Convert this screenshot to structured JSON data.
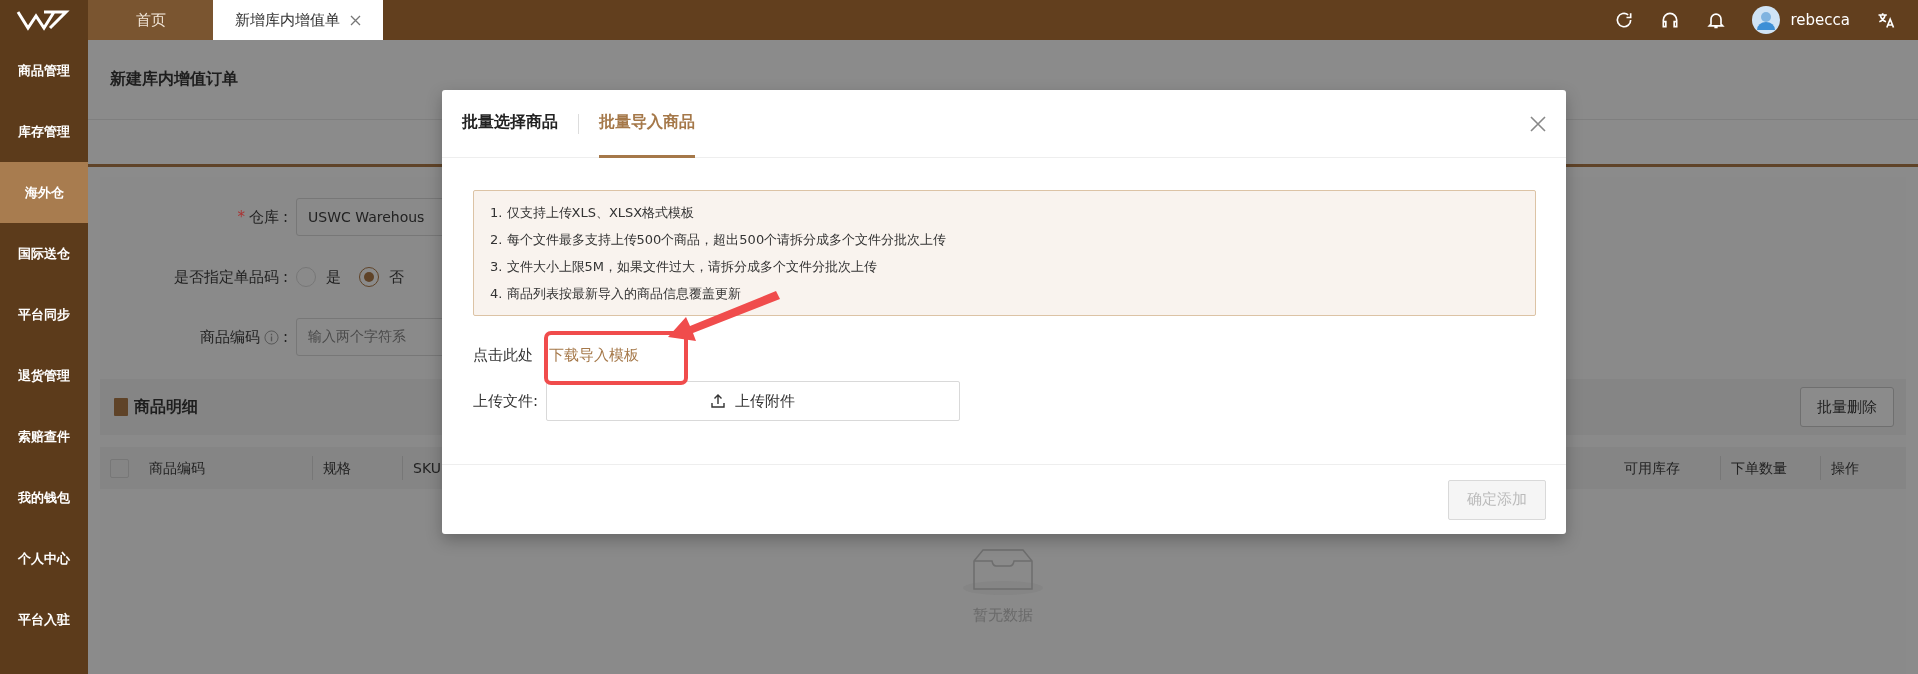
{
  "top_bar": {
    "tabs": [
      {
        "label": "首页",
        "selected": false,
        "closable": false
      },
      {
        "label": "新增库内增值单",
        "selected": true,
        "closable": true
      }
    ],
    "user": "rebecca"
  },
  "sidebar": {
    "items": [
      {
        "label": "商品管理",
        "selected": false
      },
      {
        "label": "库存管理",
        "selected": false
      },
      {
        "label": "海外仓",
        "selected": true
      },
      {
        "label": "国际送仓",
        "selected": false
      },
      {
        "label": "平台同步",
        "selected": false
      },
      {
        "label": "退货管理",
        "selected": false
      },
      {
        "label": "索赔查件",
        "selected": false
      },
      {
        "label": "我的钱包",
        "selected": false
      },
      {
        "label": "个人中心",
        "selected": false
      },
      {
        "label": "平台入驻",
        "selected": false
      }
    ]
  },
  "page": {
    "title": "新建库内增值订单",
    "form": [
      {
        "kind": "select",
        "required_mark": "*",
        "label": "仓库",
        "suffix": ":",
        "value": "USWC Warehous"
      },
      {
        "kind": "radio",
        "label": "是否指定单品码",
        "suffix": ":",
        "options": [
          {
            "label": "是",
            "selected": false
          },
          {
            "label": "否",
            "selected": true
          }
        ]
      },
      {
        "kind": "input",
        "label": "商品编码",
        "info": true,
        "suffix": ":",
        "placeholder": "输入两个字符系"
      }
    ],
    "select_all_checked": false,
    "details": {
      "title": "商品明细",
      "button": "批量删除",
      "columns_left": [
        "商品编码",
        "规格",
        "SKU"
      ],
      "columns_right": [
        "可用库存",
        "下单数量",
        "操作"
      ],
      "empty_text": "暂无数据"
    }
  },
  "modal": {
    "tabs": [
      {
        "label": "批量选择商品",
        "selected": false
      },
      {
        "label": "批量导入商品",
        "selected": true
      }
    ],
    "notice": [
      "1. 仅支持上传XLS、XLSX格式模板",
      "2. 每个文件最多支持上传500个商品，超出500个请拆分成多个文件分批次上传",
      "3. 文件大小上限5M，如果文件过大，请拆分成多个文件分批次上传",
      "4. 商品列表按最新导入的商品信息覆盖更新"
    ],
    "download_prefix": "点击此处",
    "download_link": "下载导入模板",
    "upload_label": "上传文件:",
    "upload_button": "上传附件",
    "confirm": {
      "label": "确定添加",
      "disabled": true
    }
  }
}
